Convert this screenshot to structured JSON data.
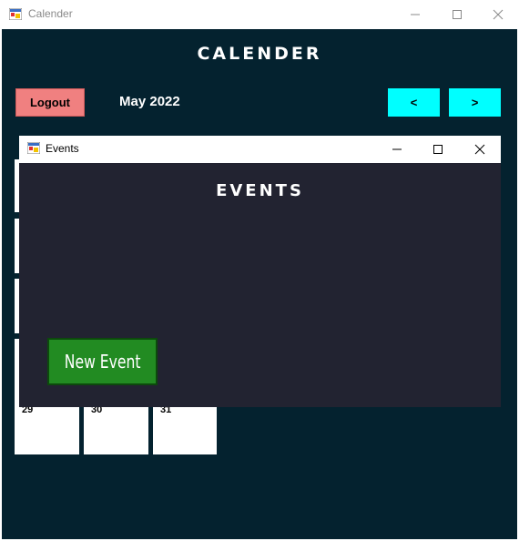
{
  "main_window": {
    "title": "Calender",
    "app_icon": "windows-forms-icon",
    "controls": [
      "minimize-icon",
      "maximize-icon",
      "close-icon"
    ]
  },
  "calendar": {
    "heading": "CALENDER",
    "logout_label": "Logout",
    "month_label": "May 2022",
    "prev_label": "<",
    "next_label": ">",
    "visible_days": [
      "29",
      "30",
      "31"
    ]
  },
  "events_window": {
    "title": "Events",
    "app_icon": "windows-forms-icon",
    "controls": [
      "minimize-icon",
      "maximize-icon",
      "close-icon"
    ],
    "heading": "EVENTS",
    "new_event_label": "New Event"
  },
  "colors": {
    "main_background": "#04222f",
    "dialog_background": "#222331",
    "logout_button": "#f08080",
    "nav_buttons": "#00ffff",
    "new_event_button": "#228b22"
  }
}
